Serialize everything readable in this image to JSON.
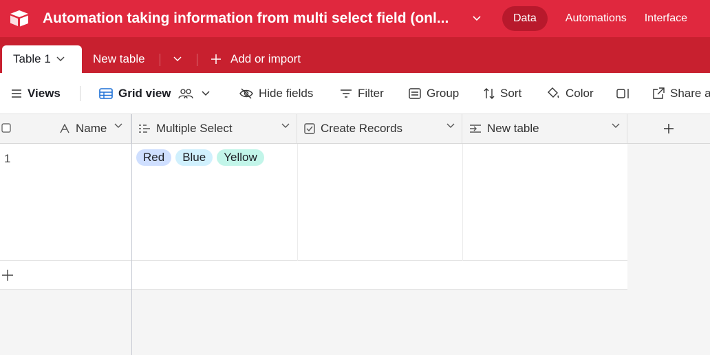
{
  "app": {
    "base_title": "Automation taking information from multi select field (onl...",
    "nav": {
      "data": "Data",
      "automations": "Automations",
      "interfaces": "Interface"
    }
  },
  "tabs": {
    "active": "Table 1",
    "new_table": "New table",
    "add_import": "Add or import"
  },
  "toolbar": {
    "views": "Views",
    "grid_view": "Grid view",
    "hide_fields": "Hide fields",
    "filter": "Filter",
    "group": "Group",
    "sort": "Sort",
    "color": "Color",
    "share": "Share a"
  },
  "columns": [
    {
      "name": "Name",
      "icon": "text-field-icon"
    },
    {
      "name": "Multiple Select",
      "icon": "multiselect-field-icon"
    },
    {
      "name": "Create Records",
      "icon": "checkbox-field-icon"
    },
    {
      "name": "New table",
      "icon": "link-field-icon"
    }
  ],
  "rows": [
    {
      "number": "1",
      "name": "",
      "multiple_select": [
        {
          "label": "Red",
          "color": "#cfdfff"
        },
        {
          "label": "Blue",
          "color": "#d0f0fd"
        },
        {
          "label": "Yellow",
          "color": "#c2f5e9"
        }
      ]
    }
  ],
  "colors": {
    "brand": "#e0283e",
    "tab_bar": "#c8202f",
    "nav_active": "#b8192c"
  }
}
